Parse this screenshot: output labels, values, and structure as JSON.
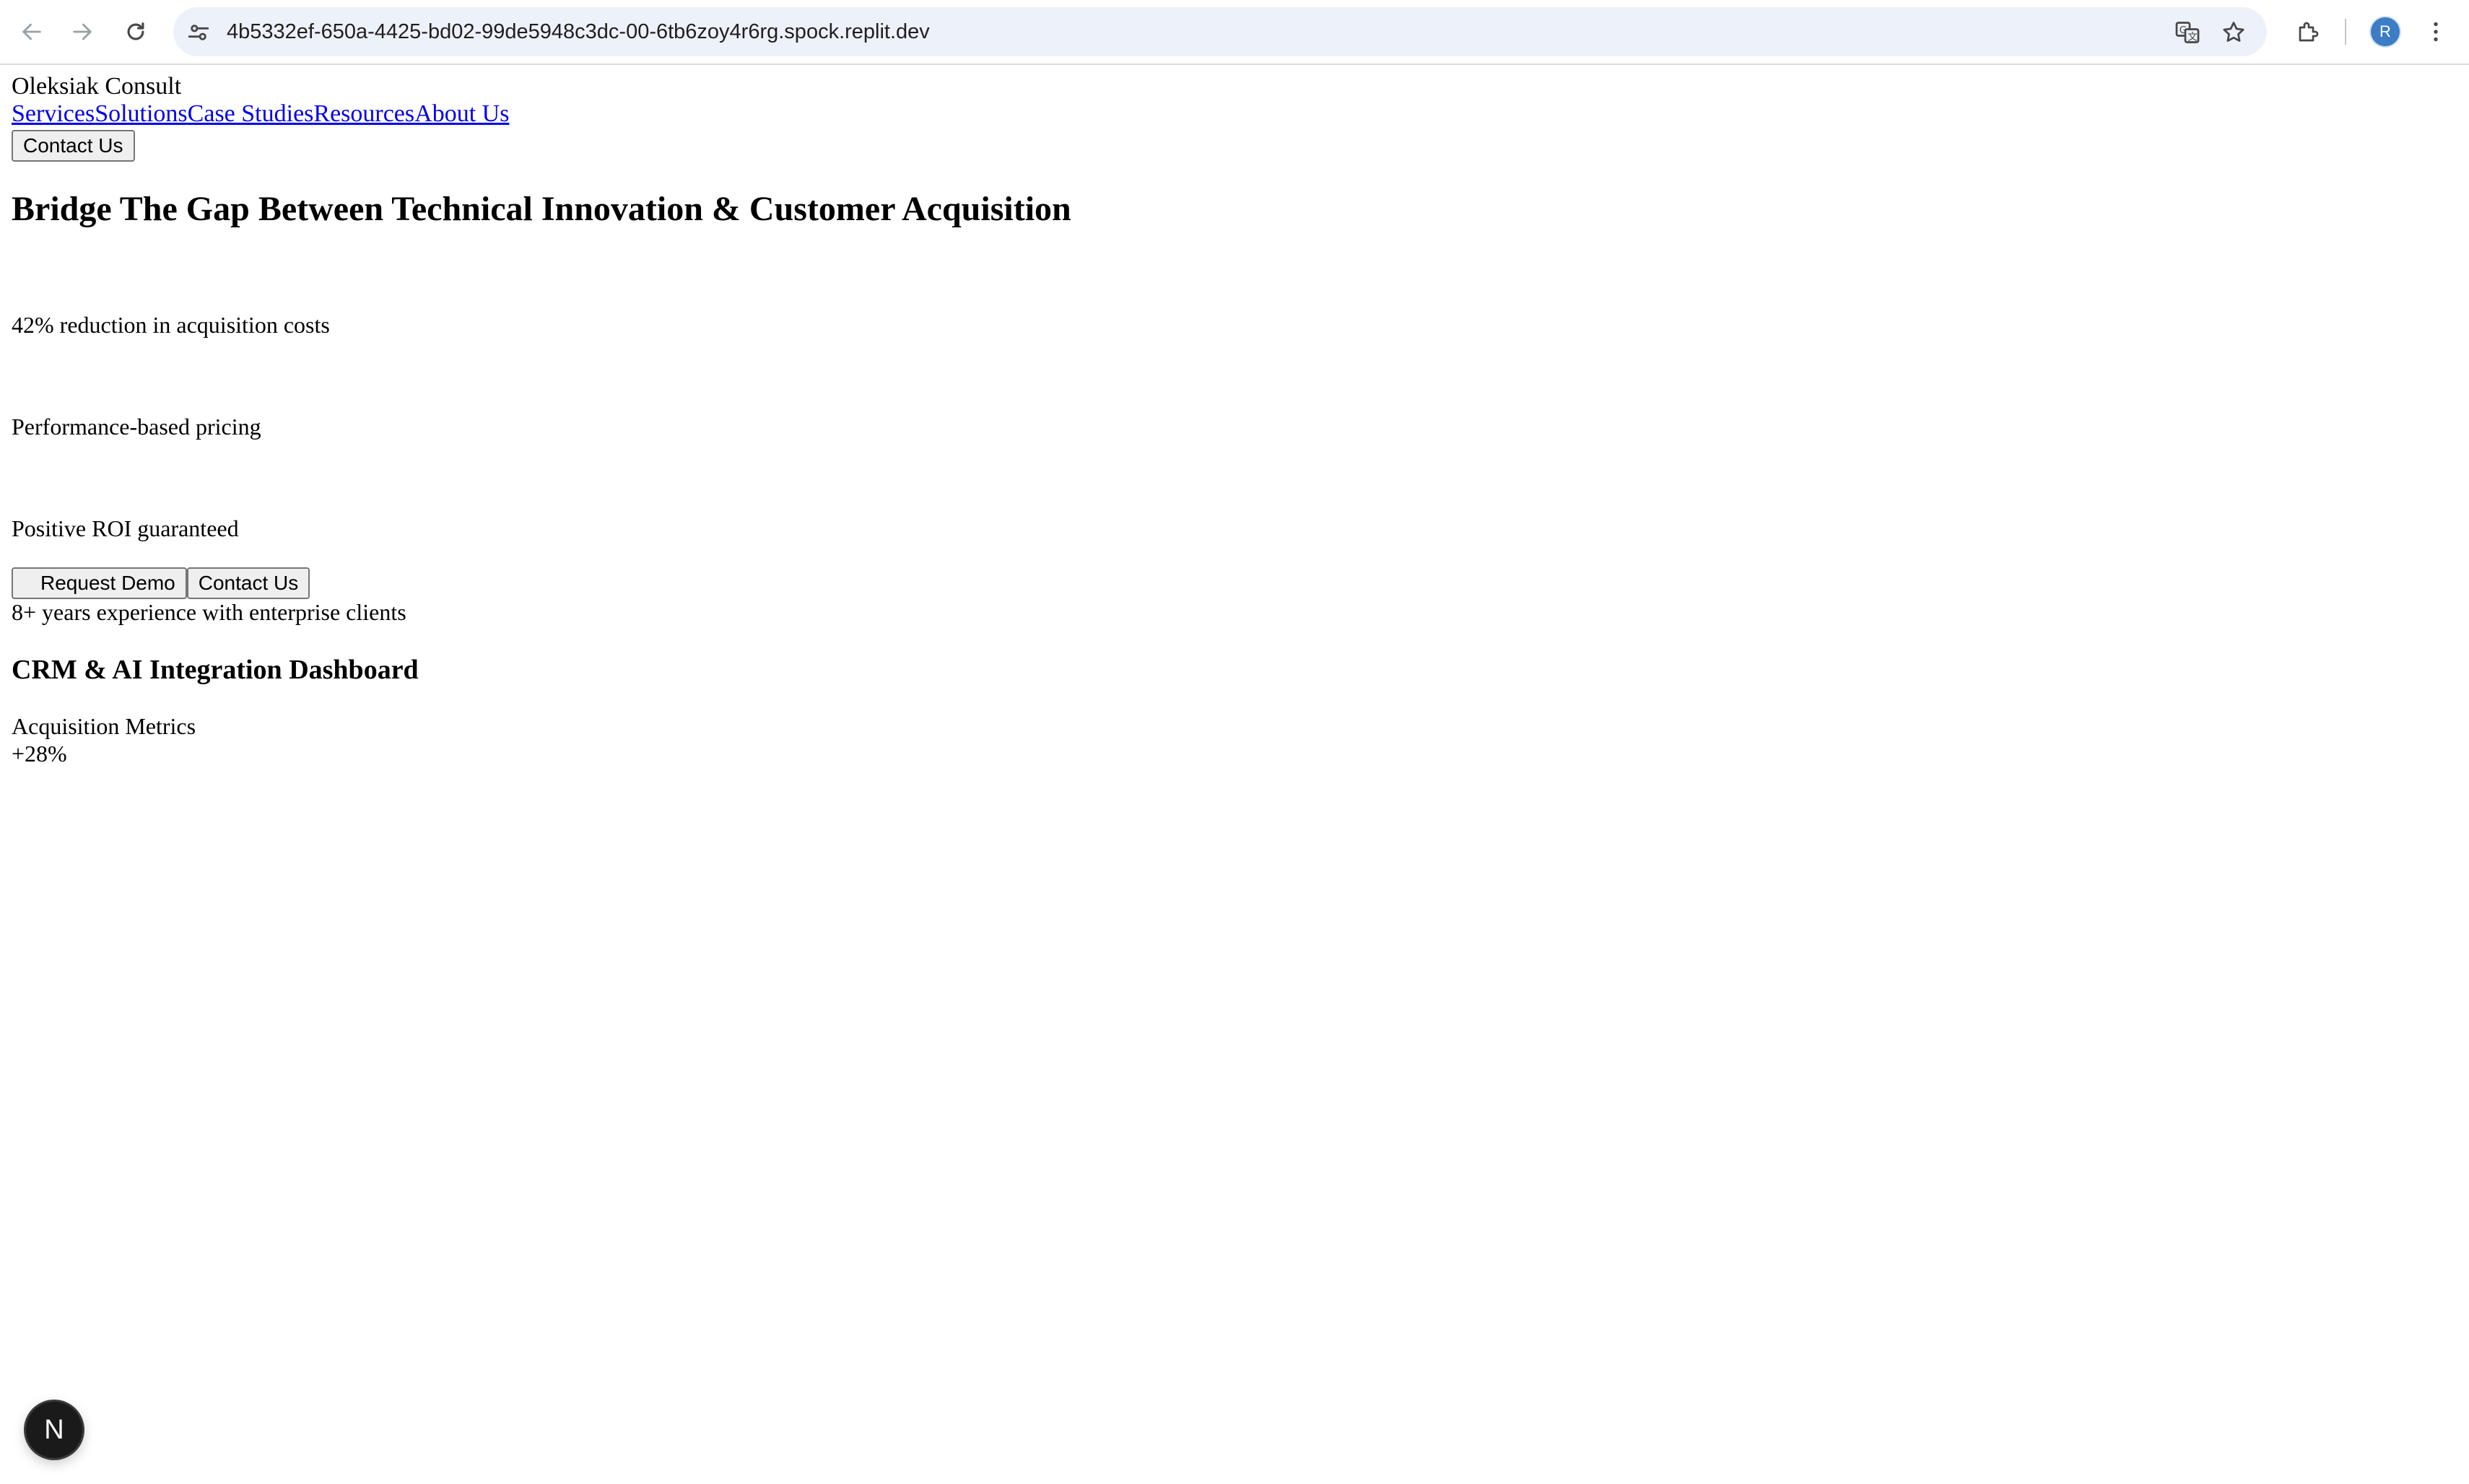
{
  "browser": {
    "url": "4b5332ef-650a-4425-bd02-99de5948c3dc-00-6tb6zoy4r6rg.spock.replit.dev",
    "profile_initial": "R"
  },
  "header": {
    "brand": "Oleksiak Consult",
    "nav": [
      "Services",
      "Solutions",
      "Case Studies",
      "Resources",
      "About Us"
    ],
    "contact_label": "Contact Us"
  },
  "hero": {
    "title": "Bridge The Gap Between Technical Innovation & Customer Acquisition",
    "features": [
      "42% reduction in acquisition costs",
      "Performance-based pricing",
      "Positive ROI guaranteed"
    ],
    "request_demo_label": "Request Demo",
    "contact_label": "Contact Us",
    "experience": "8+ years experience with enterprise clients"
  },
  "dashboard": {
    "title": "CRM & AI Integration Dashboard",
    "metric_label": "Acquisition Metrics",
    "metric_value": "+28%"
  },
  "badge": {
    "letter": "N"
  }
}
